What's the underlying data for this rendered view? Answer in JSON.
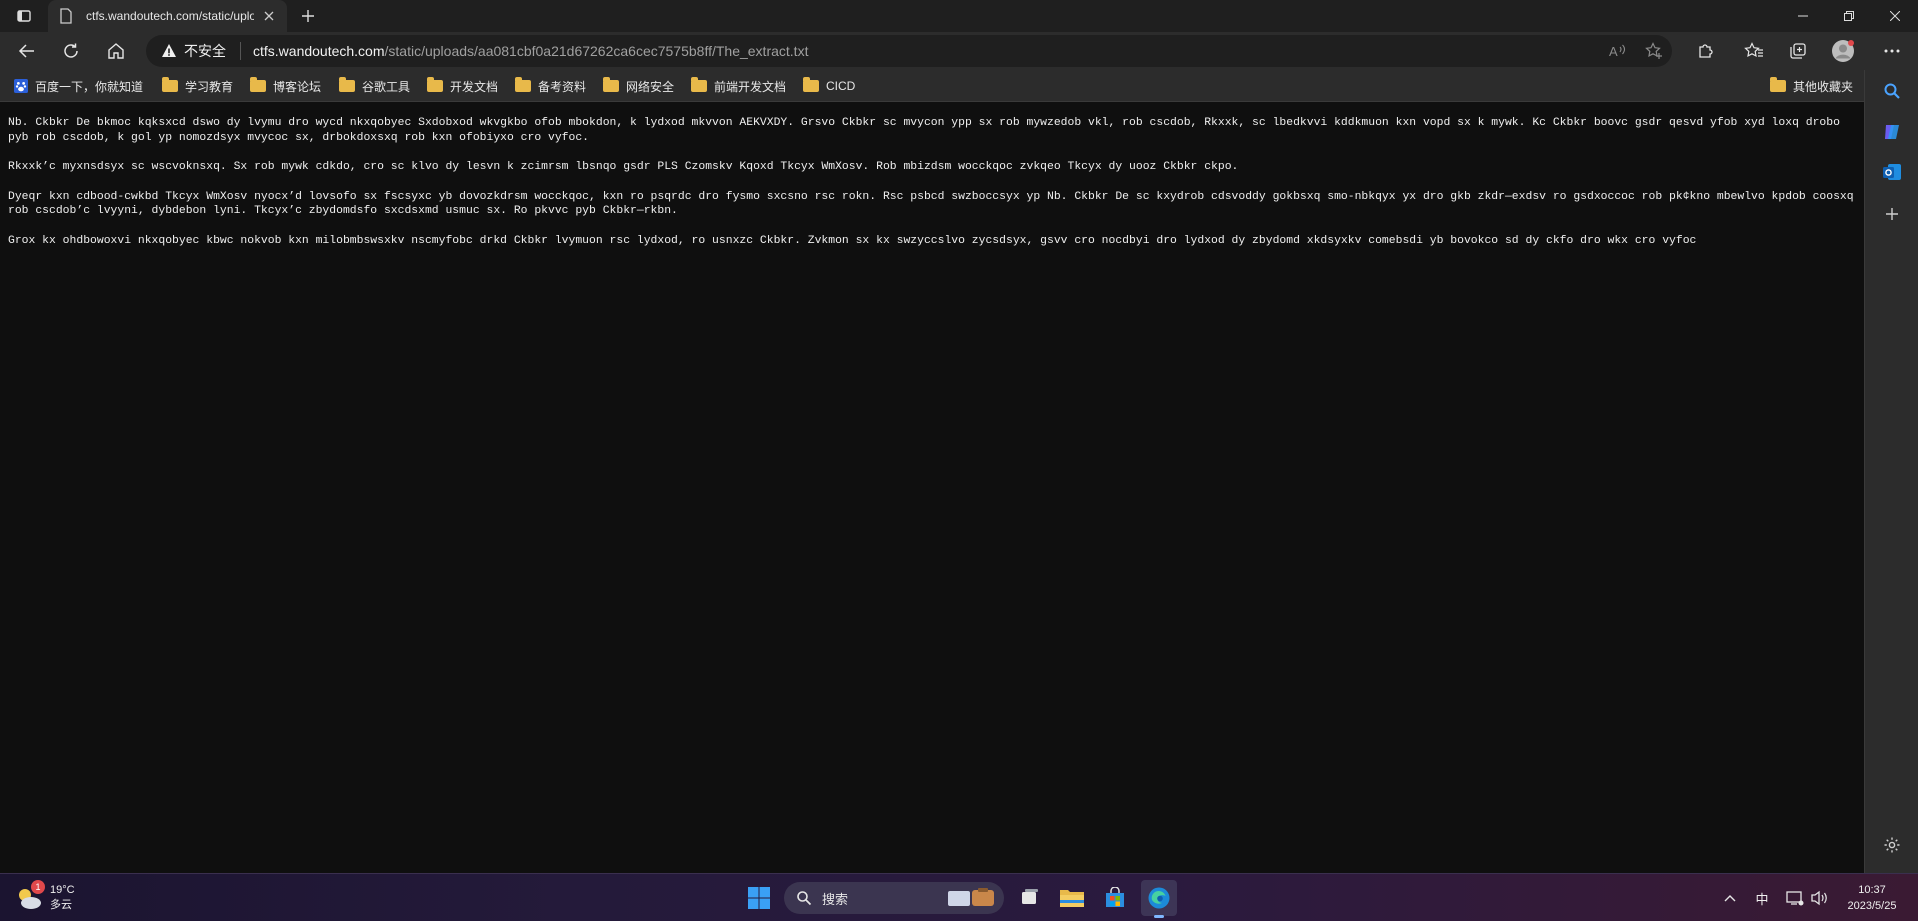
{
  "tab": {
    "title": "ctfs.wandoutech.com/static/uplo"
  },
  "address": {
    "security_label": "不安全",
    "host": "ctfs.wandoutech.com",
    "path": "/static/uploads/aa081cbf0a21d67262ca6cec7575b8ff/The_extract.txt"
  },
  "favorites": [
    {
      "label": "百度一下，你就知道",
      "icon": "baidu-icon"
    },
    {
      "label": "学习教育",
      "icon": "folder-icon"
    },
    {
      "label": "博客论坛",
      "icon": "folder-icon"
    },
    {
      "label": "谷歌工具",
      "icon": "folder-icon"
    },
    {
      "label": "开发文档",
      "icon": "folder-icon"
    },
    {
      "label": "备考资料",
      "icon": "folder-icon"
    },
    {
      "label": "网络安全",
      "icon": "folder-icon"
    },
    {
      "label": "前端开发文档",
      "icon": "folder-icon"
    },
    {
      "label": "CICD",
      "icon": "folder-icon"
    },
    {
      "label": "其他收藏夹",
      "icon": "folder-icon"
    }
  ],
  "content": {
    "paragraphs": [
      "Nb. Ckbkr De bkmoc kqksxcd dswo dy lvymu dro wycd nkxqobyec Sxdobxod wkvgkbo ofob mbokdon, k lydxod mkvvon AEKVXDY. Grsvo Ckbkr sc mvycon ypp sx rob mywzedob vkl, rob cscdob, Rkxxk, sc lbedkvvi kddkmuon kxn vopd sx k mywk. Kc Ckbkr boovc gsdr qesvd yfob xyd loxq drobo pyb rob cscdob, k gol yp nomozdsyx mvycoc sx, drbokdoxsxq rob kxn ofobiyxo cro vyfoc.",
      "Rkxxk’c myxnsdsyx sc wscvoknsxq. Sx rob mywk cdkdo, cro sc klvo dy lesvn k zcimrsm lbsnqo gsdr PLS Czomskv Kqoxd Tkcyx WmXosv. Rob mbizdsm wocckqoc zvkqeo Tkcyx dy uooz Ckbkr ckpo.",
      "Dyeqr kxn cdbood-cwkbd Tkcyx WmXosv nyocx’d lovsofo sx fscsyxc yb dovozkdrsm wocckqoc, kxn ro psqrdc dro fysmo sxcsno rsc rokn. Rsc psbcd swzboccsyx yp Nb. Ckbkr De sc kxydrob cdsvoddy gokbsxq smo-nbkqyx yx dro gkb zkdr—exdsv ro gsdxoccoc rob pk¢kno mbewlvo kpdob coosxq rob cscdob’c lvyyni, dybdebon lyni. Tkcyx’c zbydomdsfo sxcdsxmd usmuc sx. Ro pkvvc pyb Ckbkr—rkbn.",
      "Grox kx ohdbowoxvi nkxqobyec kbwc nokvob kxn milobmbswsxkv nscmyfobc drkd Ckbkr lvymuon rsc lydxod, ro usnxzc Ckbkr. Zvkmon sx kx swzyccslvo zycsdsyx, gsvv cro nocdbyi dro lydxod dy zbydomd xkdsyxkv comebsdi yb bovokco sd dy ckfo dro wkx cro vyfoc"
    ]
  },
  "taskbar": {
    "weather_temp": "19°C",
    "weather_desc": "多云",
    "weather_badge": "1",
    "search_label": "搜索",
    "ime": "中",
    "time": "10:37",
    "date": "2023/5/25"
  },
  "colors": {
    "accent": "#e8b94a",
    "page_bg": "#0f0f0f",
    "warn": "#f0f0f0",
    "notification_badge": "#e0484b"
  }
}
